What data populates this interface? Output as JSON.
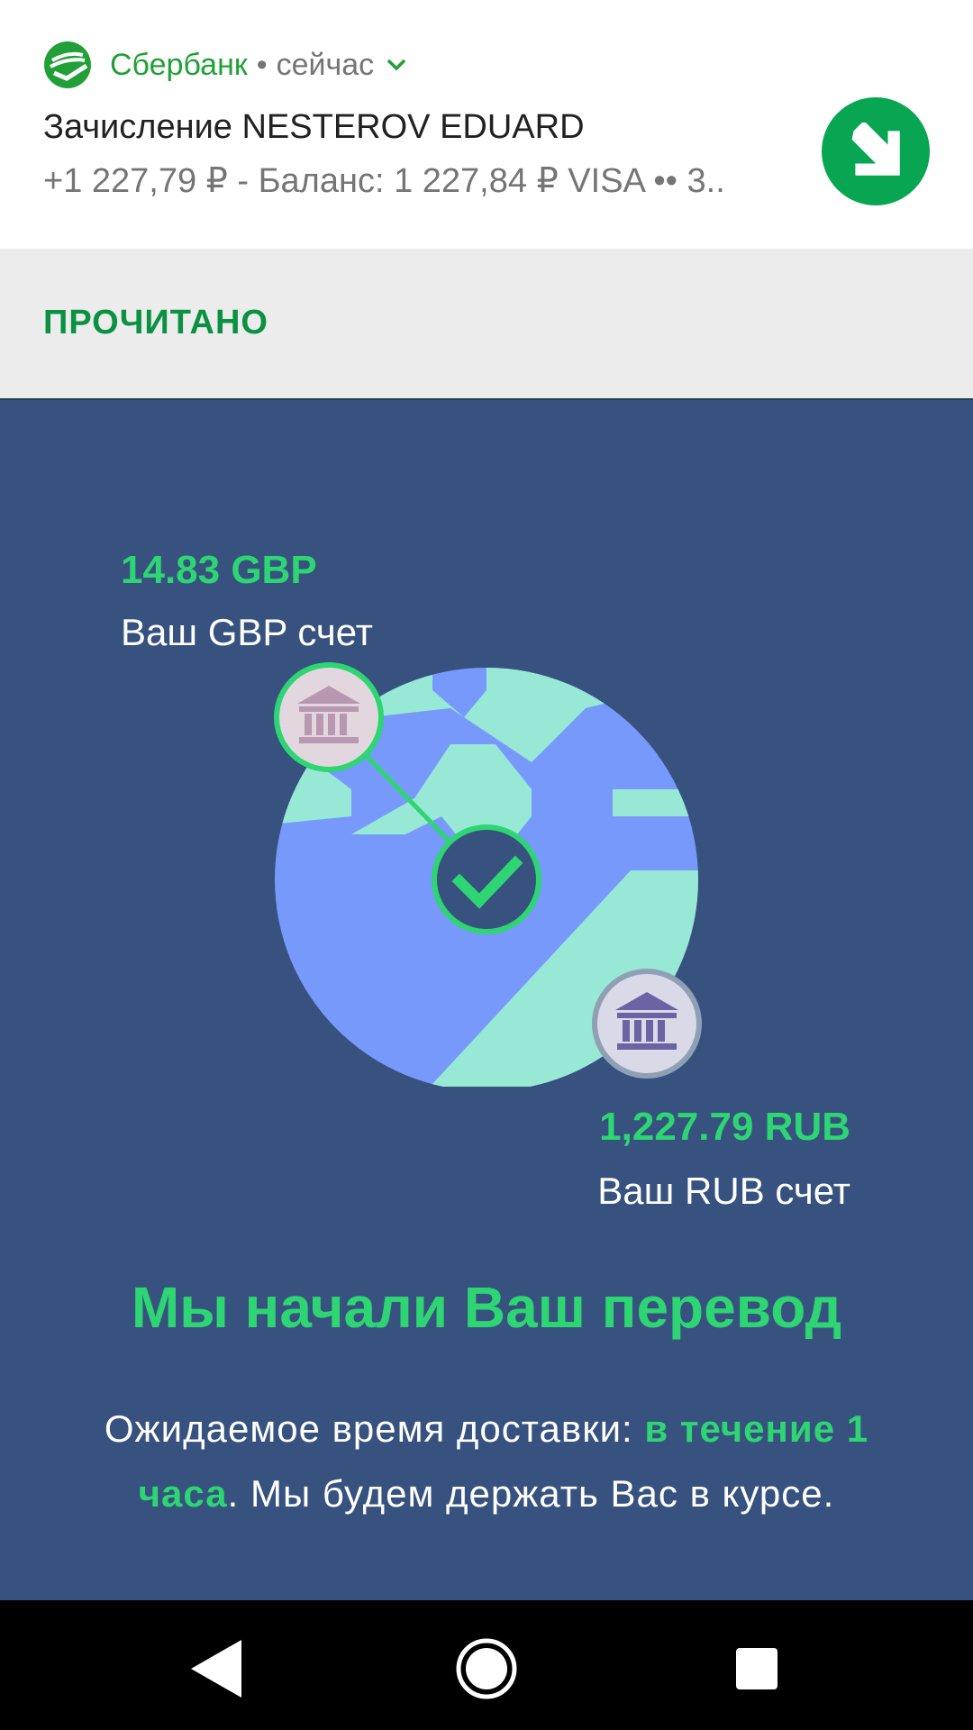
{
  "notification": {
    "app_name": "Сбербанк",
    "separator": "•",
    "time": "сейчас",
    "title": "Зачисление NESTEROV EDUARD",
    "text": "+1 227,79 ₽ - Баланс: 1 227,84 ₽ VISA •• 3..",
    "icon": "arrow-down-right-icon",
    "action_label": "ПРОЧИТАНО",
    "brand_color": "#21a038"
  },
  "transfer": {
    "from_amount": "14.83 GBP",
    "from_label": "Ваш GBP счет",
    "to_amount": "1,227.79 RUB",
    "to_label": "Ваш RUB счет",
    "heading": "Мы начали Ваш перевод",
    "delivery_prefix": "Ожидаемое время доставки: ",
    "delivery_highlight": "в течение 1 часа",
    "delivery_suffix": ". Мы будем держать Вас в курсе.",
    "accent_color": "#2ed573",
    "background_color": "#37527f"
  },
  "navbar": {
    "back": "back-icon",
    "home": "home-icon",
    "recents": "recents-icon"
  }
}
